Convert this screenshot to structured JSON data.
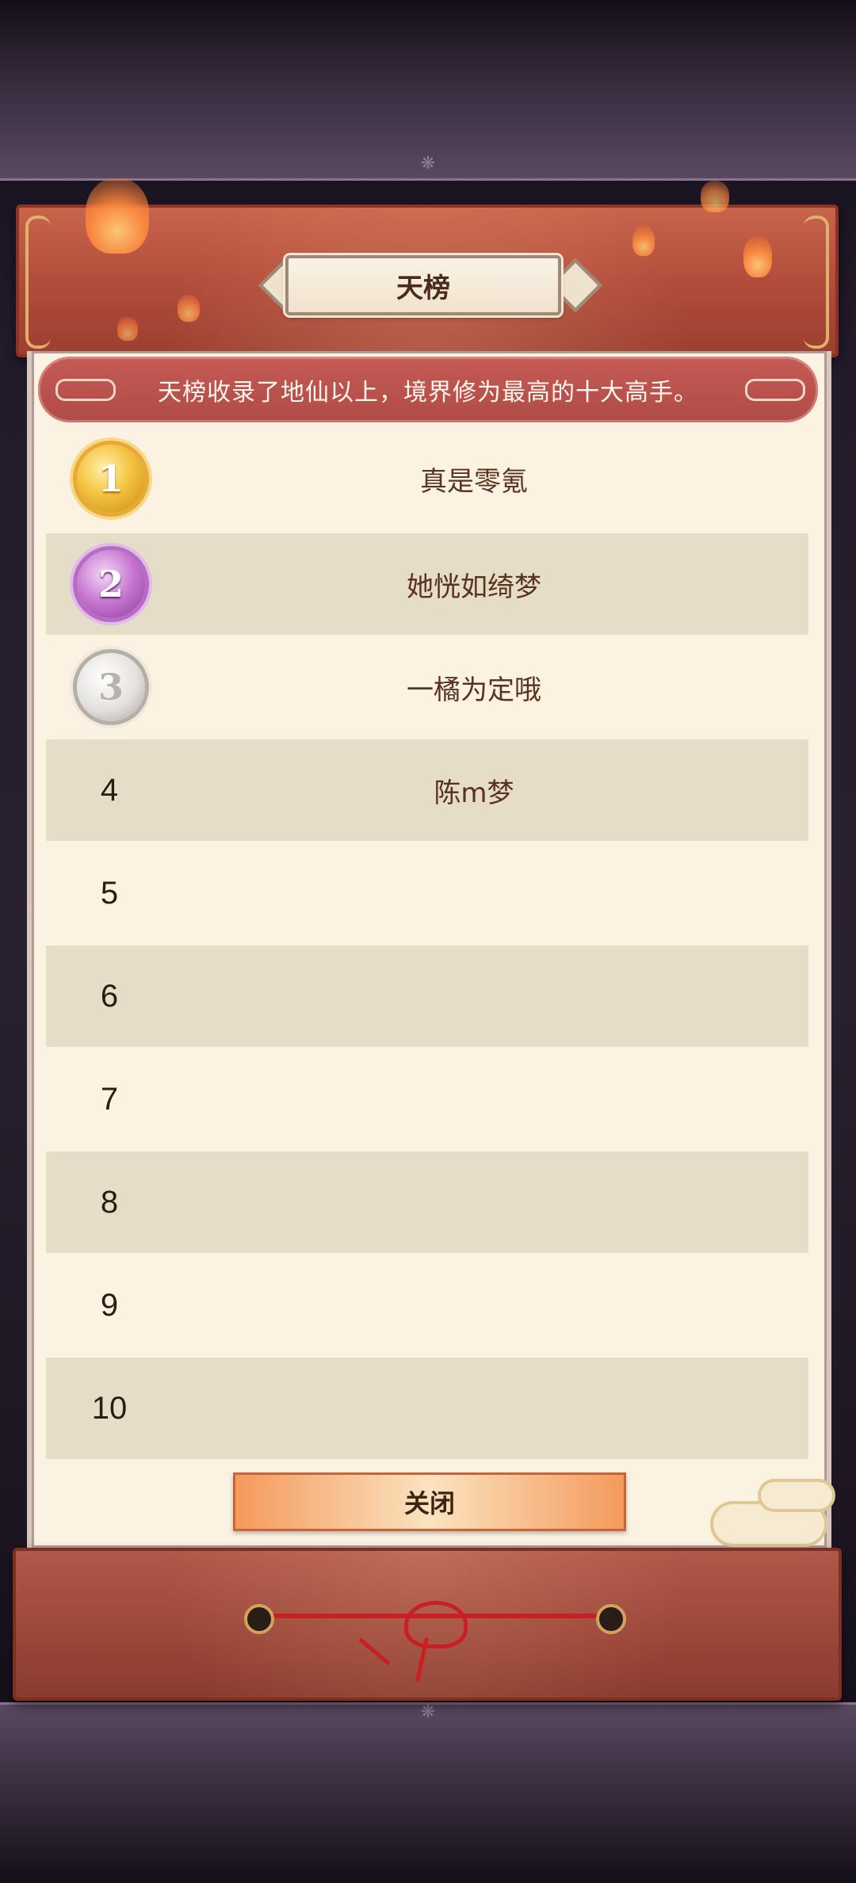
{
  "dialog": {
    "title": "天榜",
    "description": "天榜收录了地仙以上，境界修为最高的十大高手。",
    "close_label": "关闭"
  },
  "ranking": [
    {
      "rank": "1",
      "name": "真是零氪",
      "medal": "gold-medal-icon"
    },
    {
      "rank": "2",
      "name": "她恍如绮梦",
      "medal": "purple-medal-icon"
    },
    {
      "rank": "3",
      "name": "一橘为定哦",
      "medal": "silver-medal-icon"
    },
    {
      "rank": "4",
      "name": "陈m梦"
    },
    {
      "rank": "5",
      "name": ""
    },
    {
      "rank": "6",
      "name": ""
    },
    {
      "rank": "7",
      "name": ""
    },
    {
      "rank": "8",
      "name": ""
    },
    {
      "rank": "9",
      "name": ""
    },
    {
      "rank": "10",
      "name": ""
    }
  ],
  "colors": {
    "scroll_red": "#b04b3a",
    "paper": "#fbf2e2",
    "row_shade": "#e6ddc9",
    "name_text": "#5a3320",
    "banner": "#b04b47"
  }
}
